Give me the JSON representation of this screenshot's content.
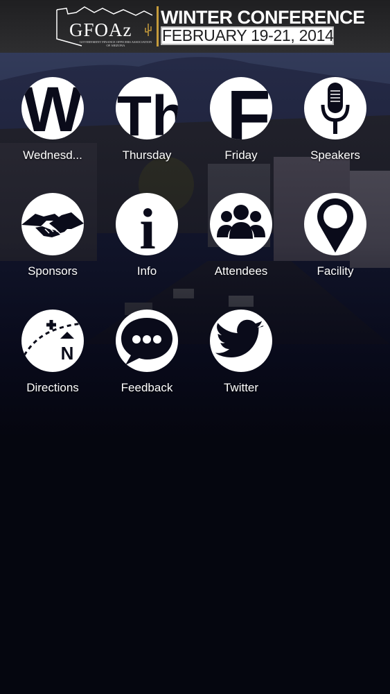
{
  "header": {
    "logo_text": "GFOAz",
    "logo_subtitle": "Government Finance Officers Association of Arizona",
    "title": "WINTER CONFERENCE",
    "dates": "FEBRUARY 19-21, 2014"
  },
  "menu": [
    {
      "label": "Wednesd...",
      "icon": "letter-w-icon",
      "glyph": "W"
    },
    {
      "label": "Thursday",
      "icon": "letters-th-icon",
      "glyph": "Th"
    },
    {
      "label": "Friday",
      "icon": "letter-f-icon",
      "glyph": "F"
    },
    {
      "label": "Speakers",
      "icon": "microphone-icon"
    },
    {
      "label": "Sponsors",
      "icon": "handshake-icon"
    },
    {
      "label": "Info",
      "icon": "info-icon",
      "glyph": "i"
    },
    {
      "label": "Attendees",
      "icon": "people-icon"
    },
    {
      "label": "Facility",
      "icon": "map-pin-icon"
    },
    {
      "label": "Directions",
      "icon": "compass-map-icon",
      "glyph": "N"
    },
    {
      "label": "Feedback",
      "icon": "speech-bubble-icon"
    },
    {
      "label": "Twitter",
      "icon": "twitter-bird-icon"
    }
  ],
  "colors": {
    "header_bg": "#2e2e30",
    "accent": "#c59b3b",
    "background": "#05060f",
    "icon_fill": "#ffffff",
    "icon_glyph": "#0a0b1a"
  }
}
